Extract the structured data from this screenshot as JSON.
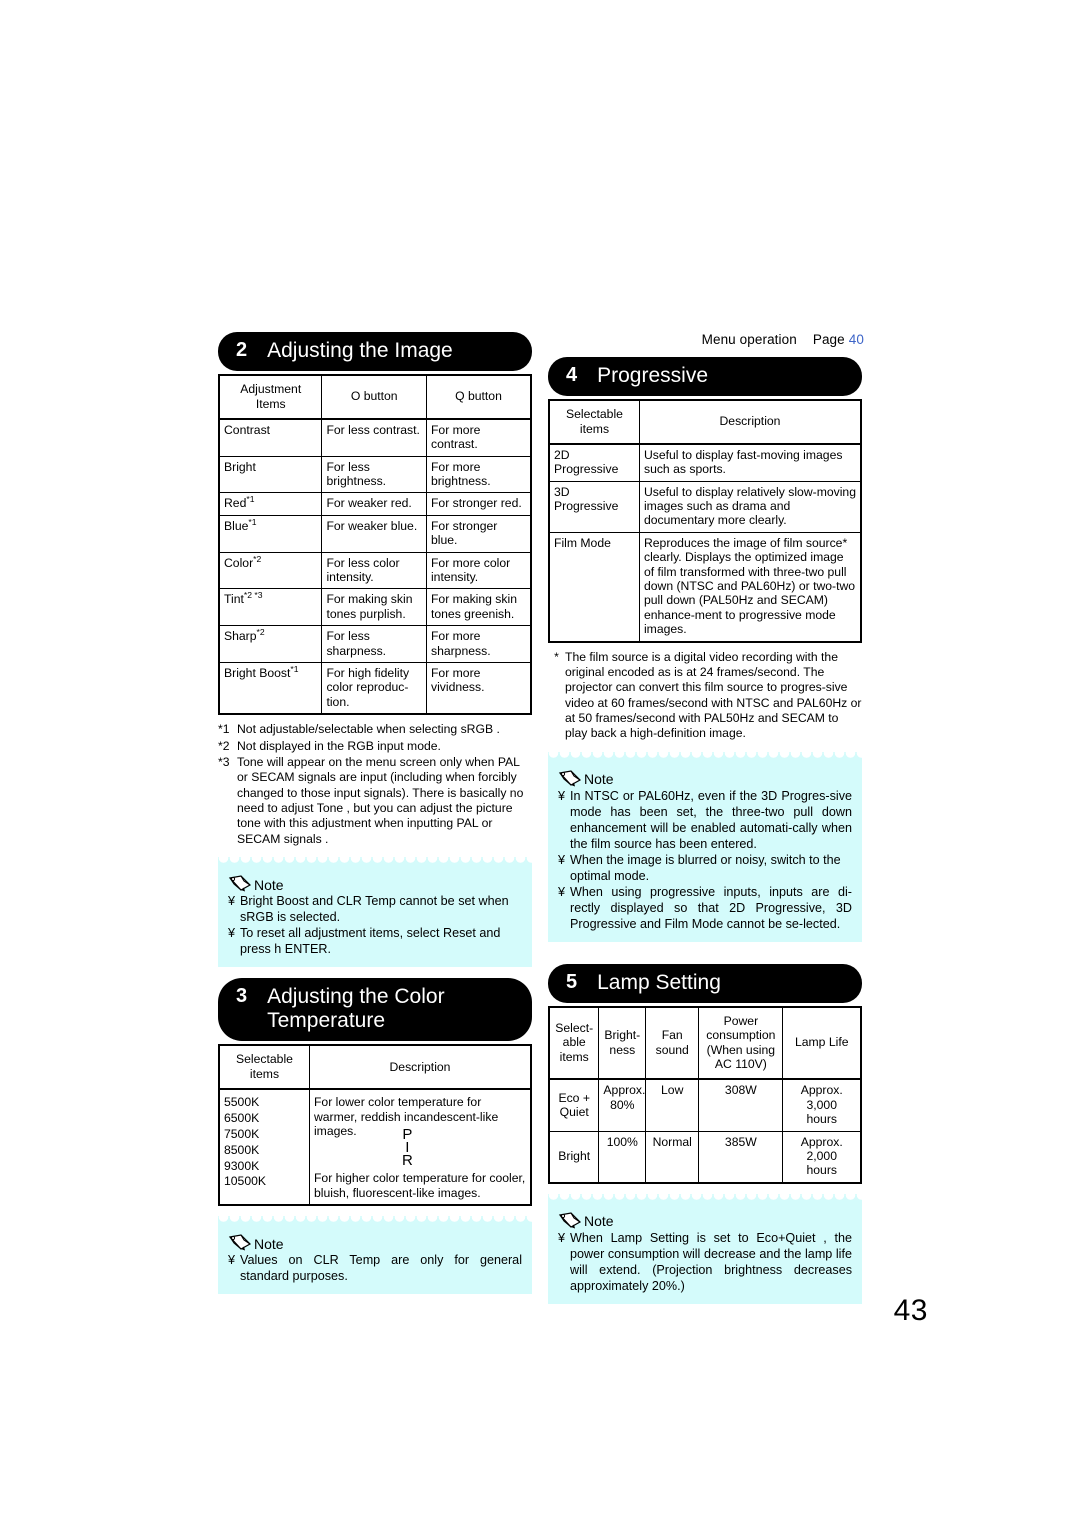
{
  "page": {
    "folio": "43",
    "running_head": {
      "label": "Menu operation",
      "page_word": "Page",
      "page_number": "40",
      "link_color": "#3c64c8"
    },
    "note_bg_color": "#d4fbfb"
  },
  "section2": {
    "number": "2",
    "title": "Adjusting the Image",
    "table": {
      "headers": [
        "Adjustment Items",
        "O button",
        "Q button"
      ],
      "headers_lines": [
        [
          "Adjustment",
          "Items"
        ],
        [
          "O button"
        ],
        [
          "Q button"
        ]
      ],
      "rows": [
        {
          "item": "Contrast",
          "item_sup": "",
          "less": "For less contrast.",
          "more": "For more contrast."
        },
        {
          "item": "Bright",
          "item_sup": "",
          "less": "For less brightness.",
          "more": "For more brightness."
        },
        {
          "item": "Red",
          "item_sup": "*1",
          "less": "For weaker red.",
          "more": "For stronger red."
        },
        {
          "item": "Blue",
          "item_sup": "*1",
          "less": "For weaker blue.",
          "more": "For stronger blue."
        },
        {
          "item": "Color",
          "item_sup": "*2",
          "less": "For less color intensity.",
          "more": "For more color intensity."
        },
        {
          "item": "Tint",
          "item_sup": "*2 *3",
          "less": "For making skin tones purplish.",
          "more": "For making skin tones greenish."
        },
        {
          "item": "Sharp",
          "item_sup": "*2",
          "less": "For less sharpness.",
          "more": "For more sharpness."
        },
        {
          "item": "Bright Boost",
          "item_sup": "*1",
          "less": "For high fidelity color reproduc-tion.",
          "more": "For more vividness."
        }
      ]
    },
    "footnotes": [
      {
        "mark": "*1",
        "text": "Not adjustable/selectable when selecting sRGB ."
      },
      {
        "mark": "*2",
        "text": "Not displayed in the RGB input mode."
      },
      {
        "mark": "*3",
        "text": "Tone  will appear on the menu screen only when PAL or SECAM signals are input (including when forcibly changed to those input signals). There is basically no need to adjust  Tone , but you can adjust the picture tone with this adjustment when inputting PAL or SECAM signals ."
      }
    ],
    "note": {
      "label": "Note",
      "items": [
        "Bright Boost  and  CLR Temp  cannot be set when  sRGB  is selected.",
        "To reset all adjustment items, select  Reset  and press h   ENTER."
      ],
      "bullet": "¥"
    }
  },
  "section3": {
    "number": "3",
    "title_lines": [
      "Adjusting the Color",
      "Temperature"
    ],
    "table": {
      "headers_lines": [
        [
          "Selectable",
          "items"
        ],
        [
          "Description"
        ]
      ],
      "items": [
        "5500K",
        "6500K",
        "7500K",
        "8500K",
        "9300K",
        "10500K"
      ],
      "description_top": "For lower color temperature for warmer, reddish incandescent-like images.",
      "description_bottom": "For higher color temperature for cooler, bluish, fluorescent-like images.",
      "artifact_glyph": [
        "P",
        "I",
        "R"
      ]
    },
    "note": {
      "label": "Note",
      "items": [
        "Values on  CLR Temp  are only for general standard purposes."
      ],
      "bullet": "¥"
    }
  },
  "section4": {
    "number": "4",
    "title": "Progressive",
    "table": {
      "headers_lines": [
        [
          "Selectable",
          "items"
        ],
        [
          "Description"
        ]
      ],
      "rows": [
        {
          "item_lines": [
            "2D",
            "Progressive"
          ],
          "desc": "Useful to display fast-moving images such as sports."
        },
        {
          "item_lines": [
            "3D",
            "Progressive"
          ],
          "desc": "Useful to display relatively slow-moving images such as drama and documentary more clearly."
        },
        {
          "item_lines": [
            "Film Mode"
          ],
          "desc": "Reproduces the image of film source* clearly. Displays the optimized image of film transformed with three-two pull down (NTSC and PAL60Hz) or two-two pull down (PAL50Hz and SECAM) enhance-ment to progressive mode images."
        }
      ]
    },
    "footnotes": [
      {
        "mark": "*",
        "text": "The film source is a digital video recording with the original encoded as is at 24 frames/second. The projector can convert this film source to progres-sive video at 60 frames/second with NTSC and PAL60Hz or at 50 frames/second with PAL50Hz and SECAM to play back a high-definition image."
      }
    ],
    "note": {
      "label": "Note",
      "items": [
        "In NTSC or PAL60Hz, even if the 3D Progres-sive mode has been set, the three-two pull down enhancement will be enabled automati-cally when the film source has been entered.",
        "When the image is blurred or noisy, switch to the optimal mode.",
        "When using progressive inputs, inputs are di-rectly displayed so that 2D Progressive, 3D Progressive and Film Mode cannot be se-lected."
      ],
      "bullet": "¥"
    }
  },
  "section5": {
    "number": "5",
    "title": "Lamp Setting",
    "table": {
      "headers_lines": [
        [
          "Select-",
          "able",
          "items"
        ],
        [
          "Bright-",
          "ness"
        ],
        [
          "Fan",
          "sound"
        ],
        [
          "Power",
          "consumption",
          "(When using",
          "AC 110V)"
        ],
        [
          "Lamp Life"
        ]
      ],
      "rows": [
        {
          "item_lines": [
            "Eco +",
            "Quiet"
          ],
          "brightness_lines": [
            "Approx.",
            "80%"
          ],
          "fan_sound": "Low",
          "power": "308W",
          "lamp_life_lines": [
            "Approx.",
            "3,000",
            "hours"
          ]
        },
        {
          "item_lines": [
            "Bright"
          ],
          "brightness_lines": [
            "100%"
          ],
          "fan_sound": "Normal",
          "power": "385W",
          "lamp_life_lines": [
            "Approx.",
            "2,000",
            "hours"
          ]
        }
      ]
    },
    "note": {
      "label": "Note",
      "items": [
        "When  Lamp Setting  is set to  Eco+Quiet , the power consumption will decrease and the lamp life will extend. (Projection brightness decreases approximately 20%.)"
      ],
      "bullet": "¥"
    }
  }
}
